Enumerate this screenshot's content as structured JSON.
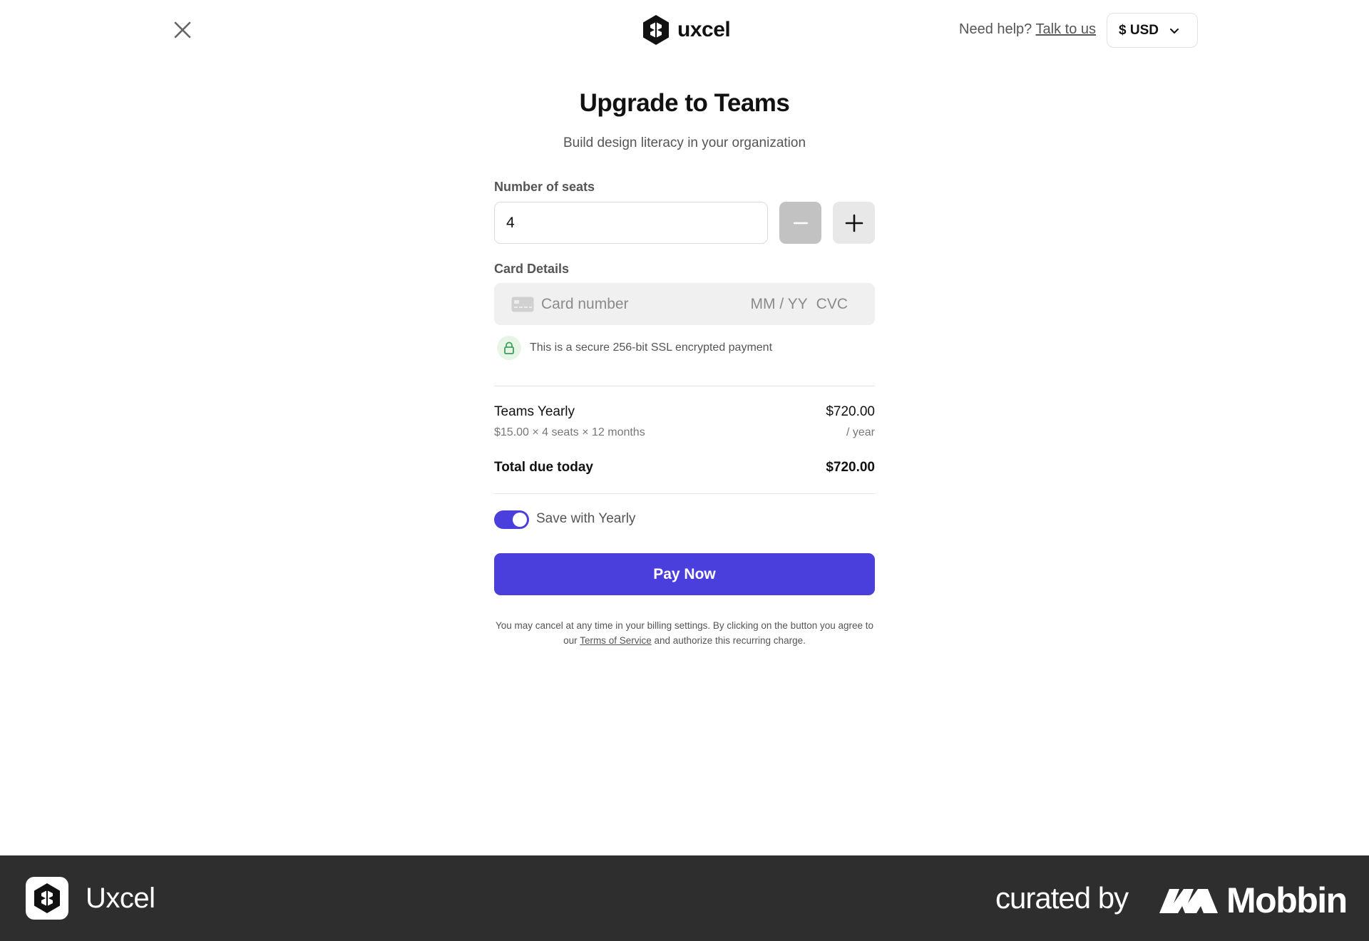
{
  "header": {
    "brand": "uxcel",
    "help_text": "Need help?",
    "help_link": "Talk to us",
    "currency": "$ USD"
  },
  "form": {
    "title": "Upgrade to Teams",
    "subtitle": "Build design literacy in your organization",
    "seats_label": "Number of seats",
    "seats_value": "4",
    "card_label": "Card Details",
    "card_number_placeholder": "Card number",
    "card_expiry_placeholder": "MM / YY",
    "card_cvc_placeholder": "CVC",
    "secure_text": "This is a secure 256-bit SSL encrypted payment"
  },
  "summary": {
    "plan_name": "Teams Yearly",
    "plan_price": "$720.00",
    "plan_breakdown": "$15.00 × 4 seats × 12 months",
    "plan_period": "/ year",
    "total_label": "Total due today",
    "total_value": "$720.00"
  },
  "billing": {
    "toggle_label": "Save with Yearly",
    "toggle_on": true,
    "pay_label": "Pay Now",
    "legal_before": "You may cancel at any time in your billing settings. By clicking on the button you agree to our ",
    "legal_link": "Terms of Service",
    "legal_after": " and authorize this recurring charge."
  },
  "footer": {
    "app_name": "Uxcel",
    "curated_by": "curated by",
    "brand": "Mobbin"
  },
  "colors": {
    "accent": "#4a3fdc",
    "footer_bg": "#2e2e2e",
    "secure_bg": "#e6f5e6",
    "secure_icon": "#3aa05a"
  },
  "icons": [
    "close-icon",
    "uxcel-logo-icon",
    "chevron-down-icon",
    "minus-icon",
    "plus-icon",
    "credit-card-icon",
    "lock-icon",
    "mobbin-logo-icon"
  ]
}
